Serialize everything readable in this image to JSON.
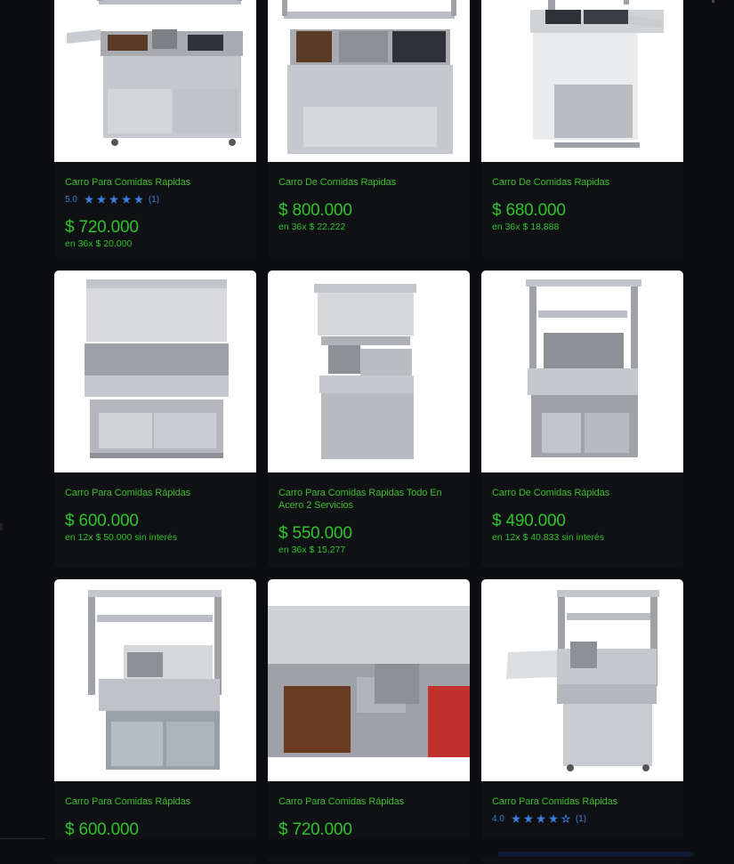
{
  "colors": {
    "background": "#0b0d10",
    "card": "#0f1114",
    "title": "#3fbf2e",
    "price": "#2fc42a",
    "rating": "#3b7fd9"
  },
  "products": [
    {
      "title": "Carro Para Comidas Rapidas",
      "rating": {
        "score": "5.0",
        "stars": 5,
        "count": "(1)"
      },
      "price": "$ 720.000",
      "installments": "en 36x $ 20.000"
    },
    {
      "title": "Carro De Comidas Rapidas",
      "price": "$ 800.000",
      "installments": "en 36x $ 22.222"
    },
    {
      "title": "Carro De Comidas Rapidas",
      "price": "$ 680.000",
      "installments": "en 36x $ 18.888"
    },
    {
      "title": "Carro Para Comidas Rápidas",
      "price": "$ 600.000",
      "installments": "en 12x $ 50.000 sin interés"
    },
    {
      "title": "Carro Para Comidas Rapidas Todo En Acero 2 Servicios",
      "price": "$ 550.000",
      "installments": "en 36x $ 15.277"
    },
    {
      "title": "Carro De Comidas Rápidas",
      "price": "$ 490.000",
      "installments": "en 12x $ 40.833 sin interés"
    },
    {
      "title": "Carro Para Comidas Rápidas",
      "price": "$ 600.000",
      "installments": ""
    },
    {
      "title": "Carro Para Comidas Rápidas",
      "price": "$ 720.000",
      "installments": ""
    },
    {
      "title": "Carro Para Comidas Rápidas",
      "rating": {
        "score": "4.0",
        "stars": 4,
        "count": "(1)"
      },
      "price": "",
      "installments": ""
    }
  ]
}
